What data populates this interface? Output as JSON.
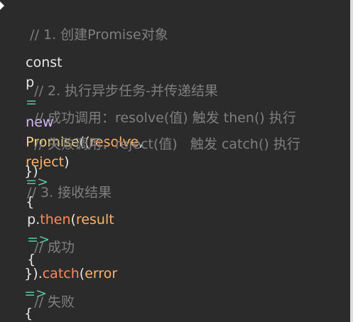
{
  "code": {
    "l1": {
      "comment": "// 1. 创建Promise对象"
    },
    "l2": {
      "const": "const",
      "var": "p",
      "assign": "=",
      "new": "new",
      "class": "Promise",
      "open": "((",
      "param1": "resolve",
      "comma": ",",
      "param2": "reject",
      "close": ")",
      "arrow": "=>",
      "brace": "{"
    },
    "l3": {
      "comment": "// 2. 执行异步任务-并传递结果"
    },
    "l4": {
      "comment": "// 成功调用：resolve(值) 触发 then() 执行"
    },
    "l5": {
      "comment": "// 失败调用：reject(值)   触发 catch() 执行"
    },
    "l6": {
      "close": "})"
    },
    "l7": {
      "comment": "// 3. 接收结果"
    },
    "l8": {
      "obj": "p",
      "dot": ".",
      "method": "then",
      "open": "(",
      "param": "result",
      "arrow": "=>",
      "brace": "{"
    },
    "l9": {
      "comment": "// 成功"
    },
    "l10": {
      "close": "})",
      "dot": ".",
      "method": "catch",
      "open": "(",
      "param": "error",
      "arrow": "=>",
      "brace": "{"
    },
    "l11": {
      "comment": "// 失败"
    },
    "l12": {
      "close": "})"
    }
  }
}
